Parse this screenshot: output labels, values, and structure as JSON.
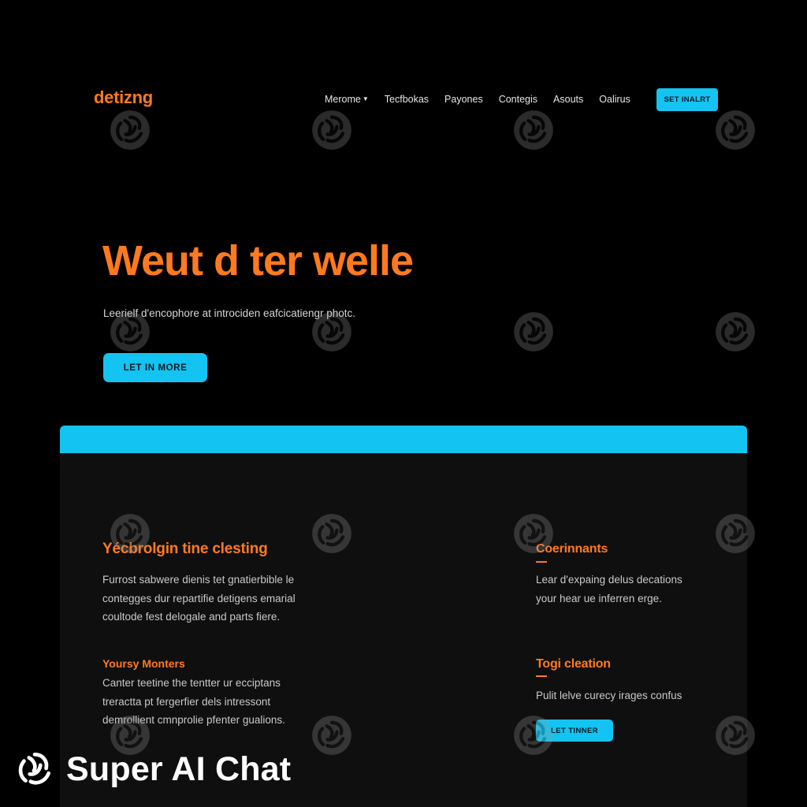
{
  "header": {
    "logo": "detizng",
    "nav": [
      "Merome",
      "Tecfbokas",
      "Payones",
      "Contegis",
      "Asouts",
      "Oalirus"
    ],
    "cta": "SET INALRT"
  },
  "hero": {
    "title": "Weut d ter welle",
    "subtitle": "Leerielf d'encophore at introciden eafcicatiengr photc.",
    "cta": "LET IN MORE"
  },
  "features": {
    "left": [
      {
        "title": "Yécbrolgin tine clesting",
        "lines": [
          "Furrost sabwere dienis tet gnatierbible le",
          "contegges dur repartifie detigens emarial",
          "coultode fest delogale and parts fiere."
        ]
      },
      {
        "title": "Yoursy Monters",
        "lines": [
          "Canter teetine the tentter ur ecciptans",
          "treractta pt fergerfier dels intressont",
          "demrollient cmnprolie pfenter gualions."
        ]
      }
    ],
    "right": [
      {
        "title": "Coerinnants",
        "lines": [
          "Lear d'expaing delus decations",
          "your hear ue inferren erge."
        ]
      },
      {
        "title": "Togi cleation",
        "lines": [
          "Pulit lelve curecy irages confus"
        ],
        "cta": "LET TINNER"
      }
    ]
  },
  "watermark": {
    "brand": "Super AI Chat",
    "icon": "super-ai-chat-logo-icon"
  },
  "colors": {
    "background": "#000000",
    "panel": "#0f0f10",
    "accent_orange": "#ff7a1f",
    "accent_cyan": "#13c4f2",
    "text": "#e6e6e6"
  }
}
